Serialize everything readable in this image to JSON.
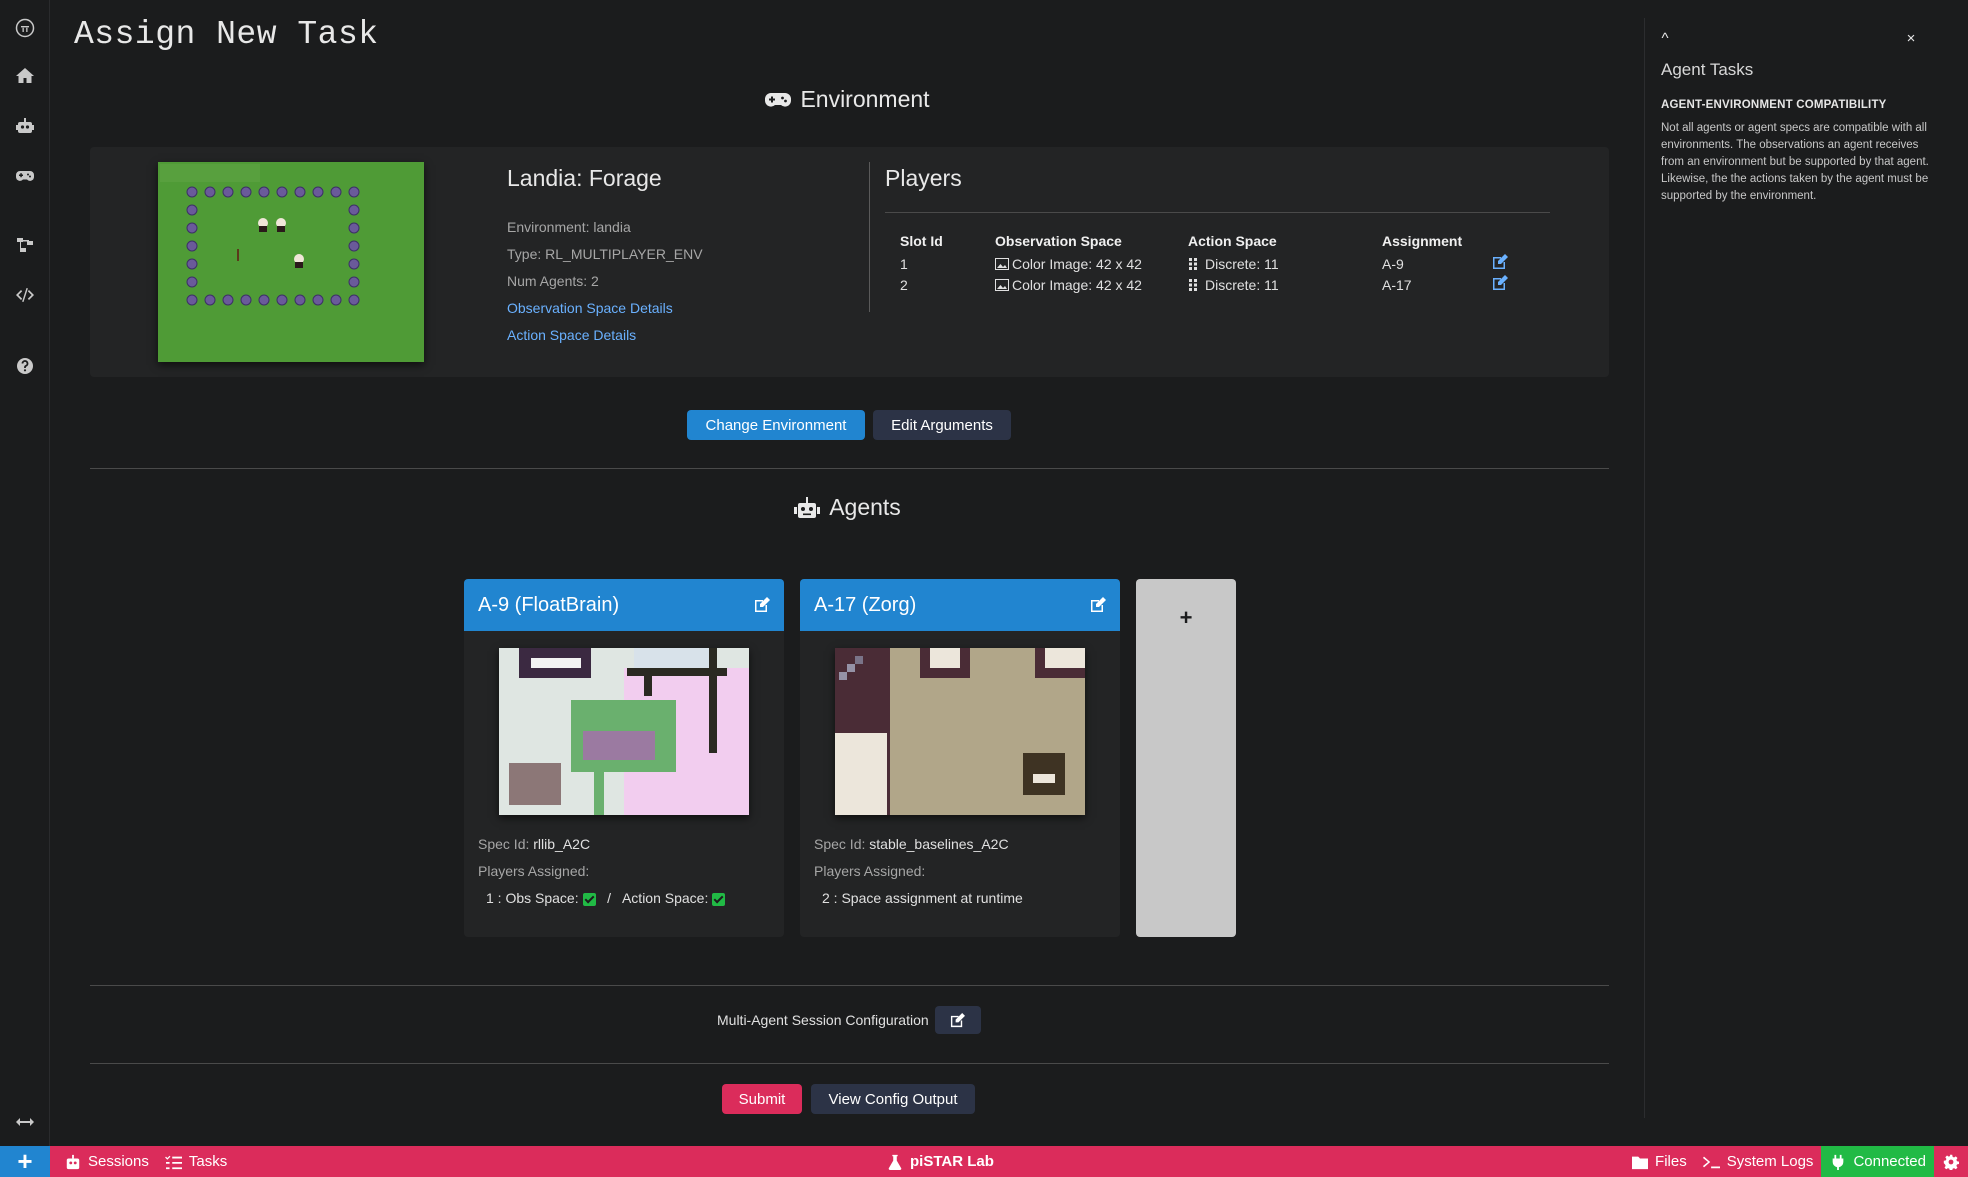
{
  "page": {
    "title": "Assign New Task"
  },
  "environment": {
    "heading": "Environment",
    "name": "Landia: Forage",
    "environment_line": "Environment: landia",
    "type_line": "Type: RL_MULTIPLAYER_ENV",
    "num_agents_line": "Num Agents: 2",
    "obs_link": "Observation Space Details",
    "action_link": "Action Space Details",
    "players_heading": "Players",
    "columns": [
      "Slot Id",
      "Observation Space",
      "Action Space",
      "Assignment"
    ],
    "rows": [
      {
        "slot": "1",
        "obs": "Color Image: 42 x 42",
        "action": "Discrete: 11",
        "assignment": "A-9"
      },
      {
        "slot": "2",
        "obs": "Color Image: 42 x 42",
        "action": "Discrete: 11",
        "assignment": "A-17"
      }
    ],
    "change_button": "Change Environment",
    "edit_args_button": "Edit Arguments"
  },
  "agents": {
    "heading": "Agents",
    "cards": [
      {
        "title": "A-9 (FloatBrain)",
        "spec_label": "Spec Id:",
        "spec_value": "rllib_A2C",
        "players_label": "Players Assigned:",
        "assign_slot": "1 : Obs Space:",
        "assign_sep": "/",
        "assign_action": "Action Space:"
      },
      {
        "title": "A-17 (Zorg)",
        "spec_label": "Spec Id:",
        "spec_value": "stable_baselines_A2C",
        "players_label": "Players Assigned:",
        "assign_text": "2 : Space assignment at runtime"
      }
    ],
    "add_label": "+"
  },
  "multi_agent": {
    "label": "Multi-Agent Session Configuration"
  },
  "actions": {
    "submit": "Submit",
    "view_config": "View Config Output"
  },
  "help_panel": {
    "title": "Agent Tasks",
    "subtitle": "AGENT-ENVIRONMENT COMPATIBILITY",
    "body": "Not all agents or agent specs are compatible with all environments. The observations an agent receives from an environment but be supported by that agent. Likewise, the the actions taken by the agent must be supported by the environment.",
    "collapse": "^",
    "close": "×"
  },
  "status_bar": {
    "add": "+",
    "sessions": "Sessions",
    "tasks": "Tasks",
    "app_name": "piSTAR Lab",
    "files": "Files",
    "system_logs": "System Logs",
    "connected": "Connected"
  },
  "colors": {
    "accent_blue": "#2185d0",
    "accent_pink": "#db2c5b",
    "connected_green": "#21ba45",
    "background": "#1b1c1d"
  },
  "icons": [
    "pistar-logo-icon",
    "home-icon",
    "robot-icon",
    "gamepad-icon",
    "workflow-icon",
    "code-icon",
    "help-icon",
    "expand-icon"
  ]
}
